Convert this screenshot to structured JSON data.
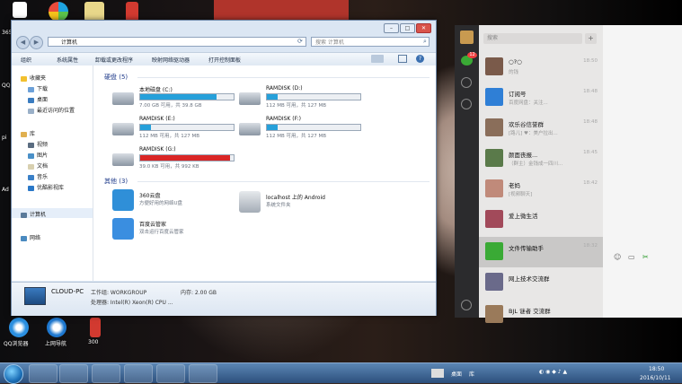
{
  "desktop": {
    "icons": [
      {
        "label": "QQ浏览器"
      },
      {
        "label": "上网导航"
      },
      {
        "label": "300"
      }
    ],
    "side_fragments": [
      "365",
      "QQ",
      "pi",
      "Ad"
    ]
  },
  "explorer": {
    "address": "计算机",
    "search_placeholder": "搜索 计算机",
    "toolbar": [
      "组织",
      "系统属性",
      "卸载或更改程序",
      "映射网络驱动器",
      "打开控制面板"
    ],
    "nav": {
      "favorites": "收藏夹",
      "favorites_items": [
        "下载",
        "桌面",
        "最近访问的位置"
      ],
      "libraries": "库",
      "library_items": [
        "视频",
        "图片",
        "文档",
        "音乐",
        "优酷影视库"
      ],
      "computer": "计算机",
      "network": "网络"
    },
    "drives_group": "硬盘 (5)",
    "drives": [
      {
        "name": "本地磁盘 (C:)",
        "size": "7.00 GB 可用，共 39.8 GB",
        "used": 0.82,
        "color": "#26a0da"
      },
      {
        "name": "RAMDISK (D:)",
        "size": "112 MB 可用，共 127 MB",
        "used": 0.12,
        "color": "#26a0da"
      },
      {
        "name": "RAMDISK (E:)",
        "size": "112 MB 可用，共 127 MB",
        "used": 0.12,
        "color": "#26a0da"
      },
      {
        "name": "RAMDISK (F:)",
        "size": "112 MB 可用，共 127 MB",
        "used": 0.12,
        "color": "#26a0da"
      },
      {
        "name": "RAMDISK (G:)",
        "size": "39.0 KB 可用，共 992 KB",
        "used": 0.96,
        "color": "#da2626"
      }
    ],
    "other_group": "其他 (3)",
    "others": [
      {
        "name": "360云盘",
        "desc": "方便好用的网络U盘"
      },
      {
        "name": "localhost 上的 Android",
        "desc": "系统文件夹"
      },
      {
        "name": "百度云管家",
        "desc": "双击运行百度云管家"
      }
    ],
    "details": {
      "pc_name": "CLOUD-PC",
      "workgroup": "工作组: WORKGROUP",
      "memory": "内存: 2.00 GB",
      "cpu": "处理器: Intel(R) Xeon(R) CPU ..."
    }
  },
  "wechat": {
    "search_placeholder": "搜索",
    "plus": "+",
    "badge_count": "12",
    "chats": [
      {
        "name": "○?○",
        "preview": "的钱",
        "time": "18:50",
        "badge": "",
        "color": "#7a5a4a"
      },
      {
        "name": "订阅号",
        "preview": "百度网盘：关注...",
        "time": "18:48",
        "badge": "",
        "color": "#2f7fd6"
      },
      {
        "name": "欢乐谷信誉群",
        "preview": "[路儿] ♥：美户拉出...",
        "time": "18:48",
        "badge": "",
        "color": "#8a6e5a"
      },
      {
        "name": "颜面丧报...",
        "preview": "（群主）金钱成一四川...",
        "time": "18:45",
        "badge": "",
        "color": "#5a7a4a"
      },
      {
        "name": "老妈",
        "preview": "[视频聊天]",
        "time": "18:42",
        "badge": "",
        "color": "#c08a7a"
      },
      {
        "name": "爱上微生活",
        "preview": "",
        "time": "",
        "badge": "",
        "color": "#a24a5a"
      },
      {
        "name": "文件传输助手",
        "preview": "",
        "time": "18:32",
        "badge": "",
        "color": "#3aaa35"
      },
      {
        "name": "网上技术交流群",
        "preview": "",
        "time": "",
        "badge": "",
        "color": "#6a6a8a"
      },
      {
        "name": "BJL 谜者 交流群",
        "preview": "",
        "time": "",
        "badge": "",
        "color": "#9a7a5a"
      }
    ]
  },
  "taskbar": {
    "tray_labels": [
      "桌面",
      "库"
    ],
    "time": "18:50",
    "date": "2016/10/11"
  }
}
